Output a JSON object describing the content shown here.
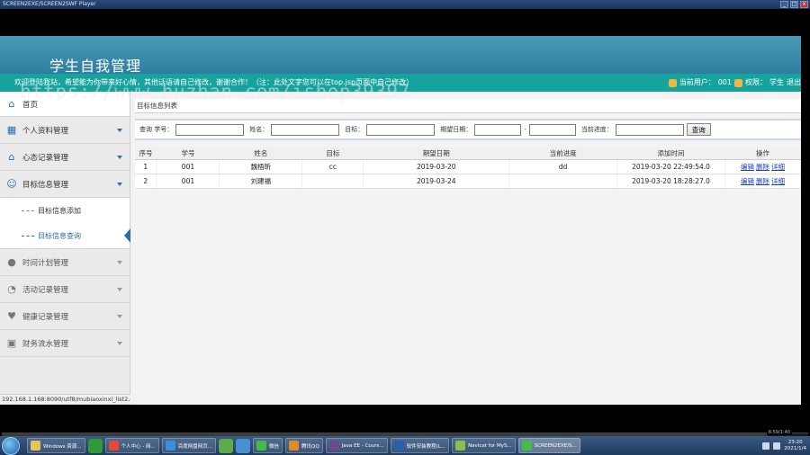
{
  "player": {
    "title": "SCREEN2EXE/SCREEN2SWF Player",
    "min": "_",
    "max": "□",
    "close": "x"
  },
  "header": {
    "title": "学生自我管理"
  },
  "notice": {
    "text": "欢迎登陆我站，希望能为你带来好心情，其他话语请自己修改，谢谢合作！（注：此处文字您可以在top.jsp页面中自己修改）",
    "current_user_label": "当前用户：",
    "current_user": "001",
    "role_label": "权限：",
    "role": "学生",
    "logout": "退出"
  },
  "watermark": "https://www.huzhan.com/ishop39397",
  "sidebar": {
    "home": "首页",
    "items": [
      {
        "label": "个人资料管理",
        "icon": "grid-icon"
      },
      {
        "label": "心态记录管理",
        "icon": "home-icon"
      },
      {
        "label": "目标信息管理",
        "icon": "users-icon"
      }
    ],
    "submenu": [
      {
        "label": "目标信息添加"
      },
      {
        "label": "目标信息查询"
      }
    ],
    "items_after": [
      {
        "label": "时间计划管理",
        "icon": "person-icon"
      },
      {
        "label": "活动记录管理",
        "icon": "chat-icon"
      },
      {
        "label": "健康记录管理",
        "icon": "heart-icon"
      },
      {
        "label": "财务流水管理",
        "icon": "bag-icon"
      }
    ],
    "status_url": "192.168.1.168:8090/utf8/mubiaoxinxi_list2.do"
  },
  "content": {
    "panel_title": "目标信息列表",
    "search": {
      "query_label": "查询 学号：",
      "name_label": "姓名：",
      "target_label": "目标：",
      "expected_date_label": "期望日期：",
      "date_sep": "-",
      "progress_label": "当前进度：",
      "query_button": "查询"
    },
    "table": {
      "headers": [
        "序号",
        "学号",
        "姓名",
        "目标",
        "期望日期",
        "当前进度",
        "添加时间",
        "操作"
      ],
      "rows": [
        {
          "no": "1",
          "sid": "001",
          "name": "魏梧昕",
          "target": "cc",
          "date": "2019-03-20",
          "progress": "dd",
          "added": "2019-03-20 22:49:54.0",
          "op1": "编辑",
          "op2": "删除",
          "op3": "详细"
        },
        {
          "no": "2",
          "sid": "001",
          "name": "刘建福",
          "target": "",
          "date": "2019-03-24",
          "progress": "",
          "added": "2019-03-20 18:28:27.0",
          "op1": "编辑",
          "op2": "删除",
          "op3": "详细"
        }
      ]
    }
  },
  "playback": {
    "time": "6:59/1:40",
    "progress": 0.95
  },
  "taskbar": {
    "tasks": [
      {
        "label": "Windows 资源..."
      },
      {
        "label": "个人中心 - 网..."
      },
      {
        "label": "百度网盘网页..."
      },
      {
        "label": "微信"
      },
      {
        "label": "腾讯QQ"
      },
      {
        "label": "Java EE - Cours..."
      },
      {
        "label": "软件安装教程(L..."
      },
      {
        "label": "Navicat for MyS..."
      },
      {
        "label": "SCREEN2EXE/S..."
      }
    ],
    "time": "23:20",
    "date": "2021/1/4"
  },
  "colors": {
    "teal": "#17a39d",
    "blue": "#2a6ea8",
    "header": "#3c8db0"
  }
}
